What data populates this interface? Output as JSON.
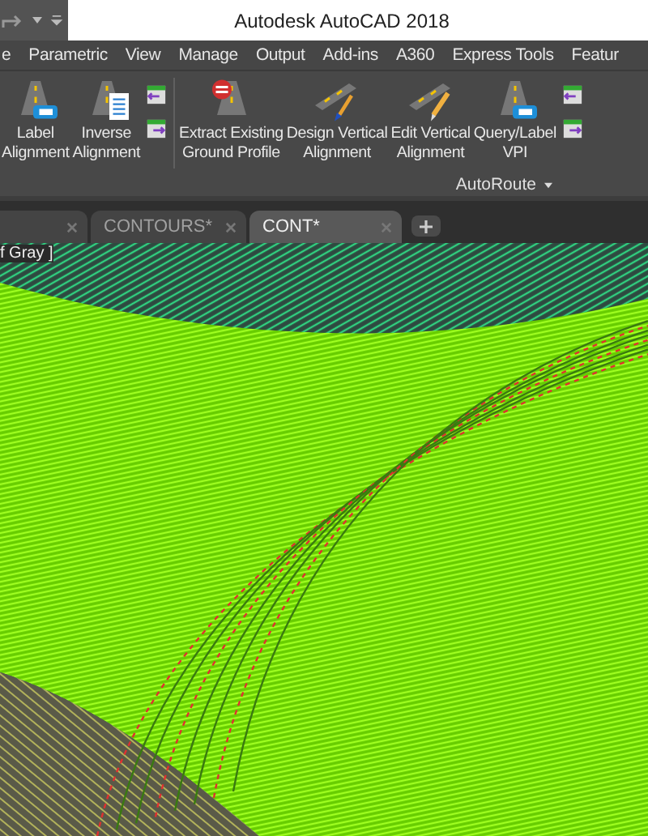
{
  "window": {
    "title": "Autodesk AutoCAD 2018"
  },
  "ribbon_tabs": [
    {
      "label": "e"
    },
    {
      "label": "Parametric"
    },
    {
      "label": "View"
    },
    {
      "label": "Manage"
    },
    {
      "label": "Output"
    },
    {
      "label": "Add-ins"
    },
    {
      "label": "A360"
    },
    {
      "label": "Express Tools"
    },
    {
      "label": "Featur"
    }
  ],
  "tool_groups": [
    {
      "tools": [
        {
          "kind": "tag",
          "lines": [
            "Label",
            "Alignment"
          ]
        },
        {
          "kind": "document",
          "lines": [
            "Inverse",
            "Alignment"
          ]
        }
      ]
    },
    {
      "tools": [
        {
          "kind": "extract",
          "lines": [
            "Extract Existing",
            "Ground Profile"
          ]
        },
        {
          "kind": "brush",
          "lines": [
            "Design Vertical",
            "Alignment"
          ]
        },
        {
          "kind": "pencil",
          "lines": [
            "Edit Vertical",
            "Alignment"
          ]
        },
        {
          "kind": "tag",
          "lines": [
            "Query/Label",
            "VPI"
          ]
        }
      ]
    }
  ],
  "panel_title": "AutoRoute",
  "doc_tabs": [
    {
      "label": "CONTOURS*",
      "selected": false
    },
    {
      "label": "CONT*",
      "selected": true
    }
  ],
  "viewport": {
    "label": "f Gray ]"
  }
}
